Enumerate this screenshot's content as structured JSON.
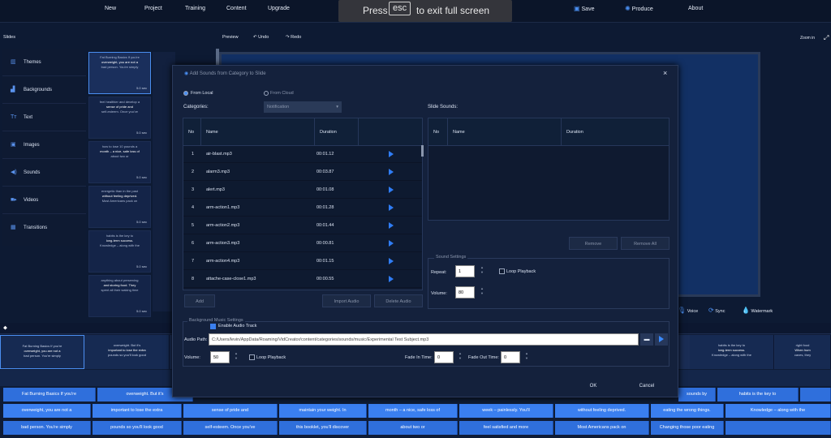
{
  "menu": {
    "new": "New",
    "project": "Project",
    "training": "Training",
    "content": "Content",
    "upgrade": "Upgrade",
    "save": "Save",
    "produce": "Produce",
    "about": "About"
  },
  "fullscreen": {
    "press": "Press",
    "key": "esc",
    "rest": "to exit full screen"
  },
  "slides_bar": {
    "title": "Slides",
    "preview": "Preview",
    "undo": "Undo",
    "redo": "Redo",
    "zoom": "Zoom in"
  },
  "sidebar": {
    "items": [
      "Themes",
      "Backgrounds",
      "Text",
      "Images",
      "Sounds",
      "Videos",
      "Transitions"
    ]
  },
  "thumbs": [
    {
      "l1": "Fat Burning Basics If you're",
      "l2": "overweight, you are not a",
      "l3": "bad person. You're simply",
      "dur": "5.0 sec"
    },
    {
      "l1": "feel healthier and develop a",
      "l2": "sense of pride and",
      "l3": "self-esteem. Once you've",
      "dur": "5.0 sec"
    },
    {
      "l1": "how to lose 10 pounds a",
      "l2": "month – a nice, safe loss of",
      "l3": "about two or",
      "dur": "5.0 sec"
    },
    {
      "l1": "energetic than in the past",
      "l2": "without feeling deprived.",
      "l3": "Most Americans pack on",
      "dur": "5.0 sec"
    },
    {
      "l1": "habits is the key to",
      "l2": "long-term success.",
      "l3": "Knowledge – along with the",
      "dur": "5.0 sec"
    },
    {
      "l1": "anything about preserving",
      "l2": "and storing food. They",
      "l3": "spent all their waking time",
      "dur": "5.0 sec"
    }
  ],
  "dialog": {
    "title": "Add Sounds from Category to Slide",
    "close": "×",
    "from_local": "From Local",
    "from_cloud": "From Cloud",
    "categories_label": "Categories:",
    "category_value": "Notification",
    "slide_sounds_label": "Slide Sounds:",
    "col_no": "No",
    "col_name": "Name",
    "col_duration": "Duration",
    "sounds": [
      {
        "no": "1",
        "name": "air-blast.mp3",
        "dur": "00:01.12"
      },
      {
        "no": "2",
        "name": "alarm3.mp3",
        "dur": "00:03.87"
      },
      {
        "no": "3",
        "name": "alert.mp3",
        "dur": "00:01.08"
      },
      {
        "no": "4",
        "name": "arm-action1.mp3",
        "dur": "00:01.28"
      },
      {
        "no": "5",
        "name": "arm-action2.mp3",
        "dur": "00:01.44"
      },
      {
        "no": "6",
        "name": "arm-action3.mp3",
        "dur": "00:00.81"
      },
      {
        "no": "7",
        "name": "arm-action4.mp3",
        "dur": "00:01.15"
      },
      {
        "no": "8",
        "name": "attache-case-close1.mp3",
        "dur": "00:00.55"
      }
    ],
    "add": "Add",
    "import_audio": "Import Audio",
    "delete_audio": "Delete Audio",
    "remove": "Remove",
    "remove_all": "Remove All",
    "sound_settings": "Sound Settings",
    "repeat_label": "Repeat:",
    "repeat_value": "1",
    "loop_playback": "Loop Playback",
    "volume_label": "Volume:",
    "volume_value": "80",
    "bg_music": "Background Music Settings",
    "enable_audio": "Enable Audio Track",
    "audio_path_label": "Audio Path:",
    "audio_path": "C:/Users/levin/AppData/Roaming/VidCreator/content/categories/sounds/music/Experimental Test Subject.mp3",
    "bg_volume_label": "Volume:",
    "bg_volume_value": "50",
    "bg_loop": "Loop Playback",
    "fade_in_label": "Fade In Time:",
    "fade_in_value": "0",
    "fade_out_label": "Fade Out Time:",
    "fade_out_value": "0",
    "ok": "OK",
    "cancel": "Cancel"
  },
  "right_controls": {
    "voice": "Voice",
    "sync": "Sync",
    "watermark": "Watermark"
  },
  "timeline": {
    "thumbs": [
      {
        "l1": "Fat Burning Basics If you're",
        "l2": "overweight, you are not a",
        "l3": "bad person. You're simply"
      },
      {
        "l1": "overweight. But it's",
        "l2": "important to lose the extra",
        "l3": "pounds so you'll look good"
      },
      {
        "l1": "habits is the key to",
        "l2": "long-term success.",
        "l3": "Knowledge – along with the"
      },
      {
        "l1": "right food",
        "l2": "When hum",
        "l3": "caves, they"
      }
    ],
    "row1": [
      "Fat Burning Basics If you're",
      "overweight. But it's",
      "sense of pride and",
      "maintain your weight. In",
      "month – a nice, safe loss of",
      "week – painlessly. You'll",
      "without feeling deprived.",
      "eating the wrong things.",
      "habits is the key to",
      "When hum"
    ],
    "row2": [
      "overweight, you are not a",
      "important to lose the extra",
      "self-esteem. Once you've",
      "this booklet, you'll discover",
      "about two or",
      "feel satisfied and more",
      "Most Americans pack on",
      "Changing those poor eating",
      "Knowledge – along with the"
    ],
    "row3": [
      "bad person. You're simply",
      "pounds so you'll look good",
      "",
      "",
      "",
      "",
      "",
      "",
      "",
      ""
    ],
    "row1b": [
      "sounds by"
    ]
  }
}
